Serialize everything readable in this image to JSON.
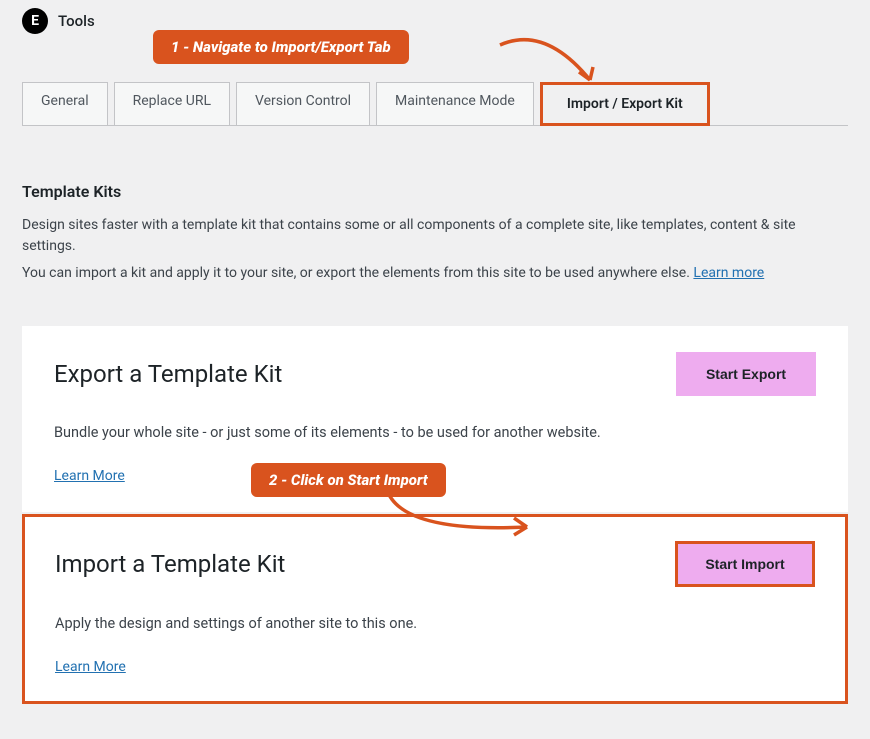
{
  "header": {
    "title": "Tools"
  },
  "tabs": [
    {
      "label": "General",
      "active": false
    },
    {
      "label": "Replace URL",
      "active": false
    },
    {
      "label": "Version Control",
      "active": false
    },
    {
      "label": "Maintenance Mode",
      "active": false
    },
    {
      "label": "Import / Export Kit",
      "active": true
    }
  ],
  "section": {
    "title": "Template Kits",
    "desc_line1": "Design sites faster with a template kit that contains some or all components of a complete site, like templates, content & site settings.",
    "desc_line2a": "You can import a kit and apply it to your site, or export the elements from this site to be used anywhere else. ",
    "desc_link": "Learn more"
  },
  "cards": [
    {
      "title": "Export a Template Kit",
      "button_label": "Start Export",
      "desc": "Bundle your whole site - or just some of its elements - to be used for another website.",
      "learn_more": "Learn More"
    },
    {
      "title": "Import a Template Kit",
      "button_label": "Start Import",
      "desc": "Apply the design and settings of another site to this one.",
      "learn_more": "Learn More"
    }
  ],
  "callouts": {
    "c1": "1 - Navigate to Import/Export Tab",
    "c2": "2 - Click on Start Import"
  }
}
